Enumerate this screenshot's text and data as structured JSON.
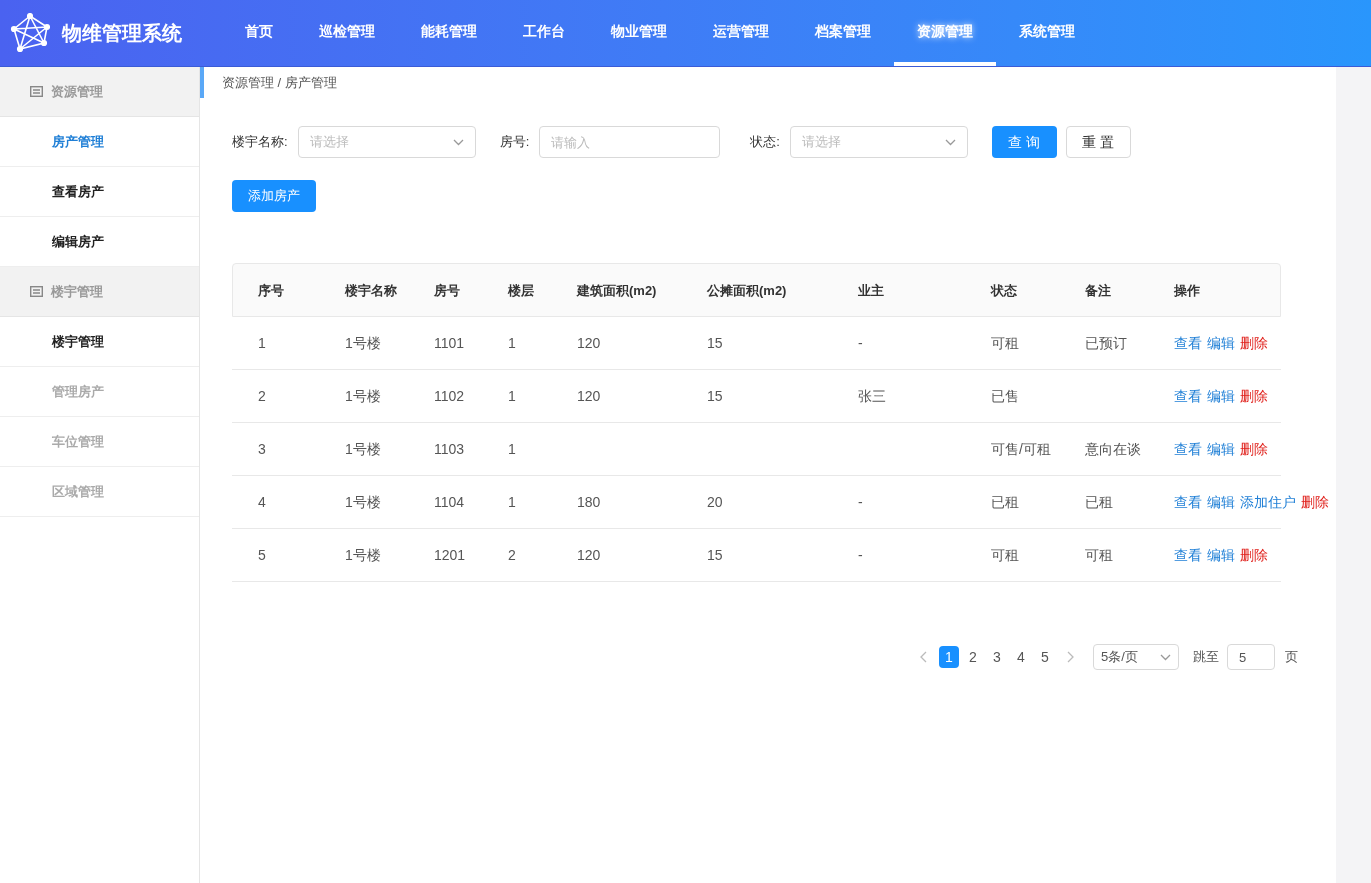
{
  "header": {
    "title": "物维管理系统",
    "nav": [
      {
        "label": "首页",
        "selected": false
      },
      {
        "label": "巡检管理",
        "selected": false
      },
      {
        "label": "能耗管理",
        "selected": false
      },
      {
        "label": "工作台",
        "selected": false
      },
      {
        "label": "物业管理",
        "selected": false
      },
      {
        "label": "运营管理",
        "selected": false
      },
      {
        "label": "档案管理",
        "selected": false
      },
      {
        "label": "资源管理",
        "selected": true
      },
      {
        "label": "系统管理",
        "selected": false
      }
    ]
  },
  "sidebar": {
    "groups": [
      {
        "label": "资源管理",
        "items": [
          {
            "label": "房产管理",
            "selected": true,
            "disabled": false
          },
          {
            "label": "查看房产",
            "selected": false,
            "disabled": false
          },
          {
            "label": "编辑房产",
            "selected": false,
            "disabled": false
          }
        ]
      },
      {
        "label": "楼宇管理",
        "items": [
          {
            "label": "楼宇管理",
            "selected": false,
            "disabled": false
          },
          {
            "label": "管理房产",
            "selected": false,
            "disabled": true
          },
          {
            "label": "车位管理",
            "selected": false,
            "disabled": true
          },
          {
            "label": "区域管理",
            "selected": false,
            "disabled": true
          }
        ]
      }
    ]
  },
  "breadcrumb": "资源管理 / 房产管理",
  "filters": [
    {
      "kind": "select",
      "label": "楼宇名称:",
      "placeholder": "请选择"
    },
    {
      "kind": "input",
      "label": "房号:",
      "placeholder": "请输入"
    },
    {
      "kind": "select",
      "label": "状态:",
      "placeholder": "请选择"
    }
  ],
  "buttons": [
    {
      "label": "查 询",
      "primary": true
    },
    {
      "label": "重 置",
      "primary": false
    }
  ],
  "add_button": "添加房产",
  "table": {
    "columns": [
      "序号",
      "楼宇名称",
      "房号",
      "楼层",
      "建筑面积(m2)",
      "公摊面积(m2)",
      "业主",
      "状态",
      "备注",
      "操作"
    ],
    "rows": [
      {
        "cells": [
          "1",
          "1号楼",
          "1101",
          "1",
          "120",
          "15",
          "-",
          "可租",
          "已预订"
        ],
        "actions": [
          {
            "kind": "view",
            "label": "查看"
          },
          {
            "kind": "edit",
            "label": "编辑"
          },
          {
            "kind": "delete",
            "label": "删除"
          }
        ]
      },
      {
        "cells": [
          "2",
          "1号楼",
          "1102",
          "1",
          "120",
          "15",
          "张三",
          "已售",
          null
        ],
        "actions": [
          {
            "kind": "view",
            "label": "查看"
          },
          {
            "kind": "edit",
            "label": "编辑"
          },
          {
            "kind": "delete",
            "label": "删除"
          }
        ]
      },
      {
        "cells": [
          "3",
          "1号楼",
          "1103",
          "1",
          null,
          null,
          null,
          "可售/可租",
          "意向在谈"
        ],
        "actions": [
          {
            "kind": "view",
            "label": "查看"
          },
          {
            "kind": "edit",
            "label": "编辑"
          },
          {
            "kind": "delete",
            "label": "删除"
          }
        ]
      },
      {
        "cells": [
          "4",
          "1号楼",
          "1104",
          "1",
          "180",
          "20",
          "-",
          "已租",
          "已租"
        ],
        "actions": [
          {
            "kind": "view",
            "label": "查看"
          },
          {
            "kind": "edit",
            "label": "编辑"
          },
          {
            "kind": "add",
            "label": "添加住户"
          },
          {
            "kind": "delete",
            "label": "删除"
          }
        ]
      },
      {
        "cells": [
          "5",
          "1号楼",
          "1201",
          "2",
          "120",
          "15",
          "-",
          "可租",
          "可租"
        ],
        "actions": [
          {
            "kind": "view",
            "label": "查看"
          },
          {
            "kind": "edit",
            "label": "编辑"
          },
          {
            "kind": "delete",
            "label": "删除"
          }
        ]
      }
    ]
  },
  "pagination": {
    "pages": [
      {
        "label": "1",
        "selected": true
      },
      {
        "label": "2",
        "selected": false
      },
      {
        "label": "3",
        "selected": false
      },
      {
        "label": "4",
        "selected": false
      },
      {
        "label": "5",
        "selected": false
      }
    ],
    "page_size": "5条/页",
    "jump_label": "跳至",
    "jump_value": "5",
    "page_suffix": "页"
  }
}
